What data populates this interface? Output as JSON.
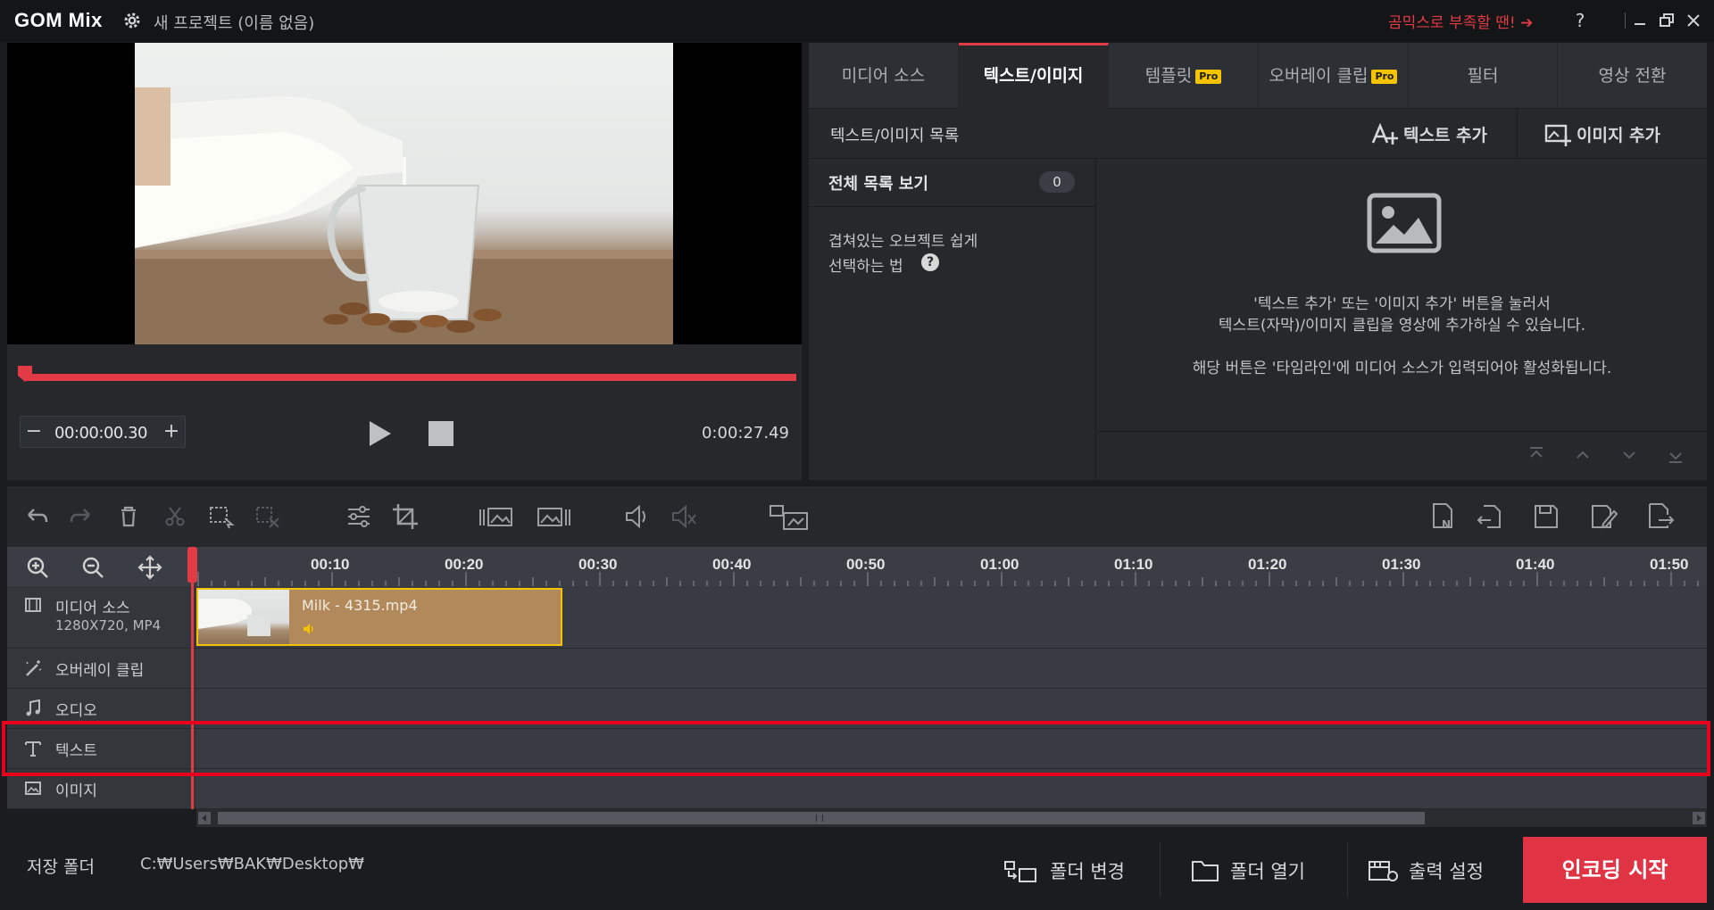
{
  "app": {
    "logo": "GOM Mix",
    "project_title": "새 프로젝트 (이름 없음)",
    "promo_link": "곰믹스로 부족할 땐! ➔",
    "help": "?"
  },
  "preview": {
    "timecode": "00:00:00.30",
    "duration": "0:00:27.49",
    "minus": "−",
    "plus": "+"
  },
  "right_panel": {
    "tabs": [
      {
        "label": "미디어 소스",
        "pro": ""
      },
      {
        "label": "텍스트/이미지",
        "pro": ""
      },
      {
        "label": "템플릿",
        "pro": "Pro"
      },
      {
        "label": "오버레이 클립",
        "pro": "Pro"
      },
      {
        "label": "필터",
        "pro": ""
      },
      {
        "label": "영상 전환",
        "pro": ""
      }
    ],
    "active_tab": "텍스트/이미지",
    "list_title": "텍스트/이미지 목록",
    "add_text": "텍스트 추가",
    "add_image": "이미지 추가",
    "view_all": "전체 목록 보기",
    "count": "0",
    "hint_line1": "겹쳐있는 오브젝트 쉽게",
    "hint_line2": "선택하는 법",
    "empty_line1": "'텍스트 추가' 또는 '이미지 추가' 버튼을 눌러서",
    "empty_line2": "텍스트(자막)/이미지 클립을 영상에 추가하실 수 있습니다.",
    "empty_line3": "해당 버튼은 '타임라인'에 미디어 소스가 입력되어야 활성화됩니다."
  },
  "timeline": {
    "ticks": [
      "00:10",
      "00:20",
      "00:30",
      "00:40",
      "00:50",
      "01:00",
      "01:10",
      "01:20",
      "01:30",
      "01:40",
      "01:50"
    ],
    "tracks": {
      "media": {
        "label": "미디어 소스",
        "sub": "1280X720, MP4"
      },
      "overlay": {
        "label": "오버레이 클립"
      },
      "audio": {
        "label": "오디오"
      },
      "text": {
        "label": "텍스트"
      },
      "image": {
        "label": "이미지"
      }
    },
    "clip_name": "Milk - 4315.mp4"
  },
  "bottom": {
    "save_folder_label": "저장 폴더",
    "save_path": "C:₩Users₩BAK₩Desktop₩",
    "change_folder": "폴더 변경",
    "open_folder": "폴더 열기",
    "output_settings": "출력 설정",
    "start_encoding": "인코딩 시작"
  },
  "colors": {
    "accent": "#e23b46",
    "pro_badge": "#f5c400",
    "clip": "#b1895b",
    "clip_border": "#f2c200",
    "highlight": "#e8001c"
  }
}
